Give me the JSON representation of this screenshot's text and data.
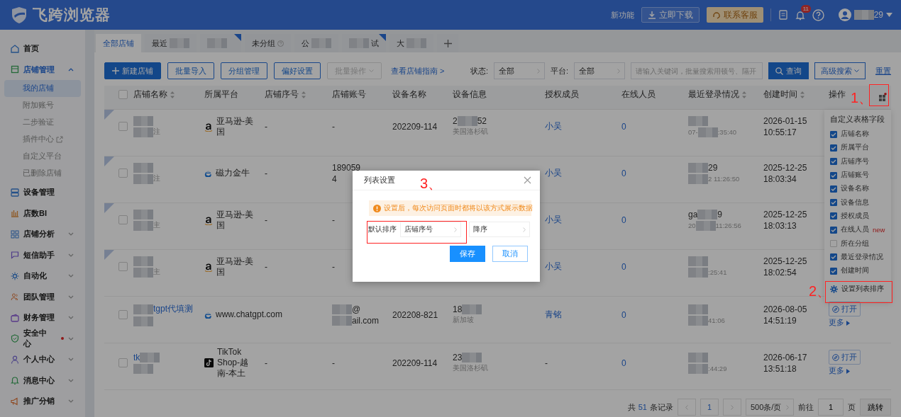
{
  "header": {
    "logo": "飞跨浏览器",
    "new_features": "新功能",
    "download": "立即下载",
    "service": "联系客服",
    "notifications": "11",
    "user": [
      {
        "kind": "blur"
      },
      "29"
    ]
  },
  "sidebar": [
    {
      "kind": "link",
      "label": "首页"
    },
    {
      "kind": "group",
      "label": "店铺管理",
      "expanded": true,
      "children": [
        {
          "label": "我的店铺",
          "selected": true,
          "external": false
        },
        {
          "label": "附加账号",
          "selected": false,
          "external": false
        },
        {
          "label": "二步验证",
          "selected": false,
          "external": false
        },
        {
          "label": "插件中心",
          "selected": false,
          "external": true
        },
        {
          "label": "自定义平台",
          "selected": false,
          "external": false
        },
        {
          "label": "已删除店铺",
          "selected": false,
          "external": false
        }
      ]
    },
    {
      "kind": "link",
      "label": "设备管理"
    },
    {
      "kind": "link",
      "label": "店数BI"
    },
    {
      "kind": "group",
      "label": "店铺分析",
      "expanded": false
    },
    {
      "kind": "group",
      "label": "短信助手",
      "expanded": false
    },
    {
      "kind": "group",
      "label": "自动化",
      "expanded": false
    },
    {
      "kind": "group",
      "label": "团队管理",
      "expanded": false
    },
    {
      "kind": "group",
      "label": "财务管理",
      "expanded": false
    },
    {
      "kind": "group",
      "label": "安全中心",
      "expanded": false,
      "dot": true
    },
    {
      "kind": "group",
      "label": "个人中心",
      "expanded": false
    },
    {
      "kind": "group",
      "label": "消息中心",
      "expanded": false
    },
    {
      "kind": "group",
      "label": "推广分销",
      "expanded": false
    }
  ],
  "tabs": [
    {
      "label": [
        "全部店铺"
      ],
      "selected": true,
      "flag": false,
      "help": false
    },
    {
      "label": [
        "最近",
        {
          "kind": "blur"
        }
      ],
      "selected": false,
      "flag": false,
      "help": false
    },
    {
      "label": [
        {
          "kind": "blur"
        }
      ],
      "selected": false,
      "flag": true,
      "help": false
    },
    {
      "label": [
        "未分组"
      ],
      "selected": false,
      "flag": false,
      "help": true
    },
    {
      "label": [
        "公",
        {
          "kind": "blur"
        }
      ],
      "selected": false,
      "flag": false,
      "help": false
    },
    {
      "label": [
        {
          "kind": "blur"
        },
        "试"
      ],
      "selected": false,
      "flag": true,
      "help": false
    },
    {
      "label": [
        "大",
        {
          "kind": "blur"
        }
      ],
      "selected": false,
      "flag": false,
      "help": false
    }
  ],
  "toolbar": {
    "buttons": [
      {
        "kind": "primary",
        "label": "新建店铺",
        "disabled": false
      },
      {
        "kind": "outline",
        "label": "批量导入",
        "disabled": false
      },
      {
        "kind": "outline",
        "label": "分组管理",
        "disabled": false
      },
      {
        "kind": "outline",
        "label": "偏好设置",
        "disabled": false
      },
      {
        "kind": "dropdown",
        "label": "批量操作",
        "disabled": true
      }
    ],
    "guide": "查看店铺指南 >",
    "filters": [
      {
        "label": "状态:",
        "value": "全部"
      },
      {
        "label": "平台:",
        "value": "全部"
      }
    ],
    "search_placeholder": "请输入关键词，批量搜索用顿号、隔开",
    "query": "查询",
    "advanced": "高级搜索",
    "reset": "重置"
  },
  "table": {
    "all_checked": false,
    "columns": [
      {
        "label": "店铺名称",
        "sortable": true
      },
      {
        "label": "所属平台",
        "sortable": false
      },
      {
        "label": "店铺序号",
        "sortable": true
      },
      {
        "label": "店铺账号",
        "sortable": false
      },
      {
        "label": "设备名称",
        "sortable": false
      },
      {
        "label": "设备信息",
        "sortable": false
      },
      {
        "label": "授权成员",
        "sortable": false
      },
      {
        "label": "在线人员",
        "sortable": false
      },
      {
        "label": "最近登录情况",
        "sortable": true
      },
      {
        "label": "创建时间",
        "sortable": true
      },
      {
        "label": "操作",
        "sortable": false
      }
    ],
    "rows": [
      {
        "flagged": true,
        "checked": false,
        "name": [
          {
            "kind": "blur"
          }
        ],
        "note": [
          {
            "kind": "blur"
          },
          "注"
        ],
        "platform": {
          "kind": "amazon",
          "label": "亚马逊-美国"
        },
        "serial": "-",
        "account": [
          [
            "-"
          ]
        ],
        "device": "202209-114",
        "info": [
          "2",
          {
            "kind": "blur"
          },
          "52"
        ],
        "location": "美国洛杉矶",
        "member": "小吴",
        "member_link": true,
        "online": "0",
        "login": [
          [
            {
              "kind": "blur"
            }
          ],
          [
            "07-",
            {
              "kind": "blur"
            },
            ":35:40"
          ]
        ],
        "created": [
          "2026-01-15",
          "10:55:17"
        ]
      },
      {
        "flagged": true,
        "checked": false,
        "name": [
          {
            "kind": "blur"
          }
        ],
        "note": [
          {
            "kind": "blur"
          },
          "注"
        ],
        "platform": {
          "kind": "edge",
          "label": "磁力金牛"
        },
        "serial": "-",
        "account": [
          [
            "189059"
          ],
          [
            "4"
          ]
        ],
        "member": "小吴",
        "member_link": true,
        "online": "0",
        "login": [
          [
            {
              "kind": "blur"
            },
            "29"
          ],
          [
            {
              "kind": "blur"
            },
            "2 11:26:50"
          ]
        ],
        "created": [
          "2025-12-25",
          "18:03:34"
        ]
      },
      {
        "flagged": true,
        "checked": false,
        "name": [
          {
            "kind": "blur"
          }
        ],
        "note": [
          {
            "kind": "blur"
          },
          "主"
        ],
        "platform": {
          "kind": "amazon",
          "label": "亚马逊-美国"
        },
        "serial": "-",
        "account": [
          [
            "-"
          ]
        ],
        "member": "小吴",
        "member_link": true,
        "online": "0",
        "login": [
          [
            "ga",
            {
              "kind": "blur"
            },
            "9"
          ],
          [
            "20",
            {
              "kind": "blur"
            },
            "11:26:56"
          ]
        ],
        "created": [
          "2025-12-25",
          "18:03:13"
        ]
      },
      {
        "flagged": true,
        "checked": false,
        "name": [
          {
            "kind": "blur"
          }
        ],
        "note": [
          {
            "kind": "blur"
          },
          "主"
        ],
        "platform": {
          "kind": "amazon",
          "label": "亚马逊-美国"
        },
        "serial": "-",
        "account": [
          [
            "-"
          ]
        ],
        "member": "小吴",
        "member_link": true,
        "online": "0",
        "login": [
          [
            {
              "kind": "blur"
            }
          ],
          [
            {
              "kind": "blur"
            },
            ":25:41"
          ]
        ],
        "created": [
          "2025-12-25",
          "18:02:54"
        ]
      },
      {
        "flagged": false,
        "checked": false,
        "name": [
          {
            "kind": "blur"
          },
          "tgpt代填测"
        ],
        "note": [
          {
            "kind": "blur"
          }
        ],
        "platform": {
          "kind": "edge",
          "label": "www.chatgpt.com"
        },
        "account": [
          [
            {
              "kind": "blur"
            },
            "@"
          ],
          [
            {
              "kind": "blur"
            },
            "ail.com"
          ]
        ],
        "device": "202208-821",
        "info": [
          "18",
          {
            "kind": "blur"
          }
        ],
        "location": "新加坡",
        "member": "青铭",
        "member_link": true,
        "online": "0",
        "login": [
          [
            {
              "kind": "blur"
            }
          ],
          [
            {
              "kind": "blur"
            },
            "41:06"
          ]
        ],
        "created": [
          "2026-08-05",
          "14:51:19"
        ],
        "actions": {
          "open": "打开",
          "more": "更多"
        }
      },
      {
        "flagged": false,
        "checked": false,
        "name": [
          "tk",
          {
            "kind": "blur"
          }
        ],
        "note": [
          {
            "kind": "blur"
          }
        ],
        "platform": {
          "kind": "tiktok",
          "label": "TikTok Shop-越南-本土"
        },
        "serial": "-",
        "account": [
          [
            "-"
          ]
        ],
        "device": "202209-114",
        "info": [
          "23",
          {
            "kind": "blur"
          }
        ],
        "location": "美国洛杉矶",
        "member": "-",
        "member_link": false,
        "online": "0",
        "login": [
          [
            {
              "kind": "blur"
            }
          ],
          [
            {
              "kind": "blur"
            },
            ":44:29"
          ]
        ],
        "created": [
          "2026-06-17",
          "13:51:18"
        ],
        "actions": {
          "open": "打开",
          "more": "更多"
        }
      }
    ]
  },
  "column_menu": {
    "title": "自定义表格字段",
    "fields": [
      {
        "label": "店铺名称",
        "checked": true
      },
      {
        "label": "所属平台",
        "checked": true
      },
      {
        "label": "店铺序号",
        "checked": true
      },
      {
        "label": "店铺账号",
        "checked": true
      },
      {
        "label": "设备名称",
        "checked": true
      },
      {
        "label": "设备信息",
        "checked": true
      },
      {
        "label": "授权成员",
        "checked": true
      },
      {
        "label": "在线人员",
        "checked": true,
        "badge": "new"
      },
      {
        "label": "所在分组",
        "checked": false
      },
      {
        "label": "最近登录情况",
        "checked": true
      },
      {
        "label": "创建时间",
        "checked": true
      }
    ],
    "sort_setting": "设置列表排序"
  },
  "pagination": {
    "total_prefix": "共",
    "total": "51",
    "total_suffix": "条记录",
    "pages": [
      {
        "label": "1",
        "selected": true
      }
    ],
    "page_size": "500条/页",
    "goto": "前往",
    "goto_value": "1",
    "page_unit": "页",
    "jump": "跳转"
  },
  "dialog": {
    "title": "列表设置",
    "notice": "设置后，每次访问页面时都将以该方式展示数据",
    "sort_label": "默认排序",
    "sort_field": "店铺序号",
    "sort_order": "降序",
    "save": "保存",
    "cancel": "取消"
  },
  "annotations": [
    "1、",
    "2、",
    "3、"
  ]
}
